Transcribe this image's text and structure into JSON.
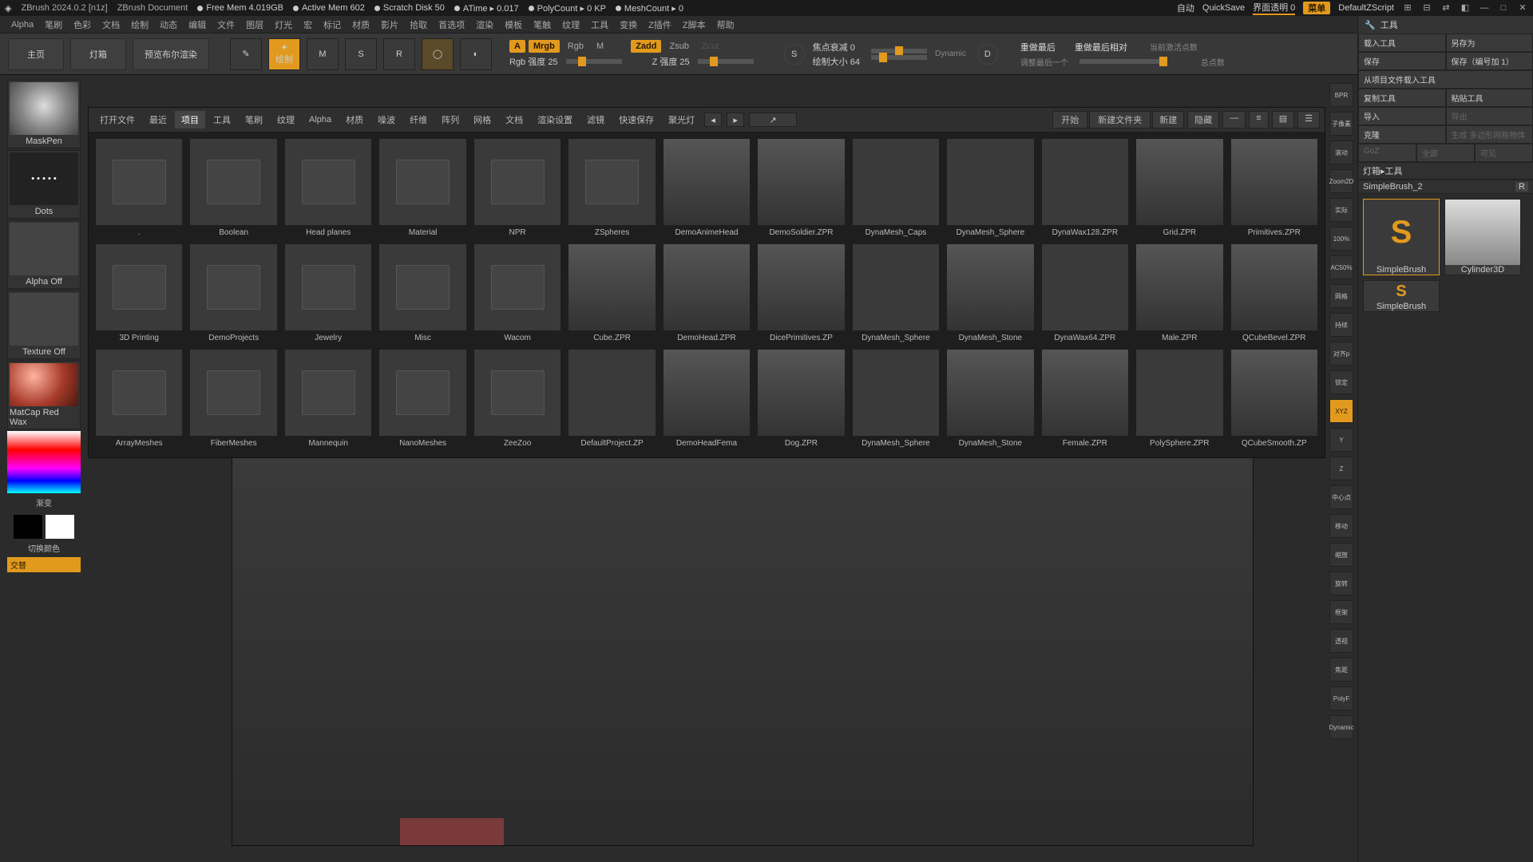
{
  "title": {
    "app": "ZBrush 2024.0.2 [n1z]",
    "doc": "ZBrush Document"
  },
  "status": [
    {
      "k": "Free Mem",
      "v": "4.019GB"
    },
    {
      "k": "Active Mem",
      "v": "602"
    },
    {
      "k": "Scratch Disk",
      "v": "50"
    },
    {
      "k": "ATime ▸",
      "v": "0.017"
    },
    {
      "k": "PolyCount ▸",
      "v": "0 KP"
    },
    {
      "k": "MeshCount ▸",
      "v": "0"
    }
  ],
  "topright": {
    "auto": "自动",
    "quicksave": "QuickSave",
    "transp": "界面透明 0",
    "menu": "菜单",
    "script": "DefaultZScript"
  },
  "menu": [
    "Alpha",
    "笔刷",
    "色彩",
    "文档",
    "绘制",
    "动态",
    "编辑",
    "文件",
    "图层",
    "灯光",
    "宏",
    "标记",
    "材质",
    "影片",
    "拾取",
    "首选项",
    "渲染",
    "模板",
    "笔触",
    "纹理",
    "工具",
    "变换",
    "Z插件",
    "Z脚本",
    "帮助"
  ],
  "shelf": {
    "tabs": [
      "主页",
      "灯箱",
      "预览布尔渲染"
    ],
    "icons": [
      {
        "n": "edit",
        "lbl": "Edit"
      },
      {
        "n": "draw",
        "lbl": "绘制",
        "on": true
      },
      {
        "n": "move",
        "lbl": "移动绘制"
      },
      {
        "n": "scale",
        "lbl": "缩放绘制"
      },
      {
        "n": "rotate",
        "lbl": "旋转绘制"
      },
      {
        "n": "sculptris",
        "lbl": ""
      },
      {
        "n": "gizmo",
        "lbl": ""
      }
    ],
    "channels": {
      "row1": [
        {
          "t": "A",
          "or": true
        },
        {
          "t": "Mrgb",
          "or": true
        },
        {
          "t": "Rgb"
        },
        {
          "t": "M"
        },
        {
          "t": "Zadd",
          "or": true
        },
        {
          "t": "Zsub"
        },
        {
          "t": "Zcut"
        }
      ],
      "rgb": {
        "lbl": "Rgb 强度",
        "v": "25"
      },
      "z": {
        "lbl": "Z 强度",
        "v": "25"
      }
    },
    "focal": {
      "lbl": "焦点衰减",
      "v": "0"
    },
    "drawsize": {
      "lbl": "绘制大小",
      "v": "64",
      "dyn": "Dynamic"
    },
    "undo": {
      "a": "重做最后",
      "b": "重做最后相对",
      "c": "当前激活点数",
      "d": "调整最后一个",
      "e": "总点数"
    }
  },
  "left": {
    "brush": "MaskPen",
    "stroke": "Dots",
    "alpha": "Alpha Off",
    "texture": "Texture Off",
    "material": "MatCap Red Wax",
    "grad": "渐变",
    "swap": "切换颜色",
    "alt": "交替"
  },
  "lightbox": {
    "tabs": [
      "打开文件",
      "最近",
      "项目",
      "工具",
      "笔刷",
      "纹理",
      "Alpha",
      "材质",
      "噪波",
      "纤维",
      "阵列",
      "网格",
      "文档",
      "渲染设置",
      "滤镜",
      "快速保存",
      "聚光灯"
    ],
    "active": "项目",
    "actions": {
      "open": "开始",
      "newfolder": "新建文件夹",
      "new": "新建",
      "hide": "隐藏"
    },
    "rows": [
      [
        {
          "t": "folder",
          "lbl": "."
        },
        {
          "t": "folder",
          "lbl": "Boolean"
        },
        {
          "t": "folder",
          "lbl": "Head planes"
        },
        {
          "t": "folder",
          "lbl": "Material"
        },
        {
          "t": "folder",
          "lbl": "NPR"
        },
        {
          "t": "folder",
          "lbl": "ZSpheres"
        },
        {
          "t": "file",
          "lbl": "DemoAnimeHead"
        },
        {
          "t": "file",
          "lbl": "DemoSoldier.ZPR"
        },
        {
          "t": "sphere",
          "lbl": "DynaMesh_Caps"
        },
        {
          "t": "sphere",
          "lbl": "DynaMesh_Sphere"
        },
        {
          "t": "sphere",
          "lbl": "DynaWax128.ZPR"
        },
        {
          "t": "file",
          "lbl": "Grid.ZPR"
        },
        {
          "t": "file",
          "lbl": "Primitives.ZPR"
        }
      ],
      [
        {
          "t": "folder",
          "lbl": "3D Printing"
        },
        {
          "t": "folder",
          "lbl": "DemoProjects"
        },
        {
          "t": "folder",
          "lbl": "Jewelry"
        },
        {
          "t": "folder",
          "lbl": "Misc"
        },
        {
          "t": "folder",
          "lbl": "Wacom"
        },
        {
          "t": "file",
          "lbl": "Cube.ZPR"
        },
        {
          "t": "file",
          "lbl": "DemoHead.ZPR"
        },
        {
          "t": "file",
          "lbl": "DicePrimitives.ZP"
        },
        {
          "t": "sphere",
          "lbl": "DynaMesh_Sphere"
        },
        {
          "t": "file",
          "lbl": "DynaMesh_Stone"
        },
        {
          "t": "sphere",
          "lbl": "DynaWax64.ZPR"
        },
        {
          "t": "file",
          "lbl": "Male.ZPR"
        },
        {
          "t": "file",
          "lbl": "QCubeBevel.ZPR"
        }
      ],
      [
        {
          "t": "folder",
          "lbl": "ArrayMeshes"
        },
        {
          "t": "folder",
          "lbl": "FiberMeshes"
        },
        {
          "t": "folder",
          "lbl": "Mannequin"
        },
        {
          "t": "folder",
          "lbl": "NanoMeshes"
        },
        {
          "t": "folder",
          "lbl": "ZeeZoo"
        },
        {
          "t": "sphere",
          "lbl": "DefaultProject.ZP"
        },
        {
          "t": "file",
          "lbl": "DemoHeadFema"
        },
        {
          "t": "file",
          "lbl": "Dog.ZPR"
        },
        {
          "t": "sphere",
          "lbl": "DynaMesh_Sphere"
        },
        {
          "t": "file",
          "lbl": "DynaMesh_Stone"
        },
        {
          "t": "file",
          "lbl": "Female.ZPR"
        },
        {
          "t": "sphere",
          "lbl": "PolySphere.ZPR"
        },
        {
          "t": "file",
          "lbl": "QCubeSmooth.ZP"
        }
      ]
    ]
  },
  "right": {
    "hdr": "工具",
    "rows": [
      [
        "载入工具",
        "另存为"
      ],
      [
        "保存",
        "保存（编号加 1）"
      ],
      [
        "从项目文件载入工具",
        ""
      ],
      [
        "复制工具",
        "粘贴工具"
      ],
      [
        "导入",
        "导出"
      ],
      [
        "克隆",
        "生成 多边形网格物体"
      ],
      [
        "GoZ",
        "全部",
        "可见"
      ]
    ],
    "section": "灯箱▸工具",
    "current": {
      "name": "SimpleBrush_2",
      "flag": "R"
    },
    "thumbs": [
      {
        "lbl": "SimpleBrush"
      },
      {
        "lbl": "Cylinder3D"
      },
      {
        "lbl": "SimpleBrush"
      }
    ]
  },
  "iconstrip": [
    "BPR",
    "子像素",
    "滚动",
    "Zoom2D",
    "实际",
    "100%",
    "AC50%",
    "网格",
    "持续",
    "对齐p",
    "锁定",
    "XYZ",
    "Y",
    "Z",
    "中心点",
    "移动",
    "缩放",
    "旋转",
    "框架",
    "透视",
    "焦距",
    "PolyF",
    "Dynamic"
  ]
}
